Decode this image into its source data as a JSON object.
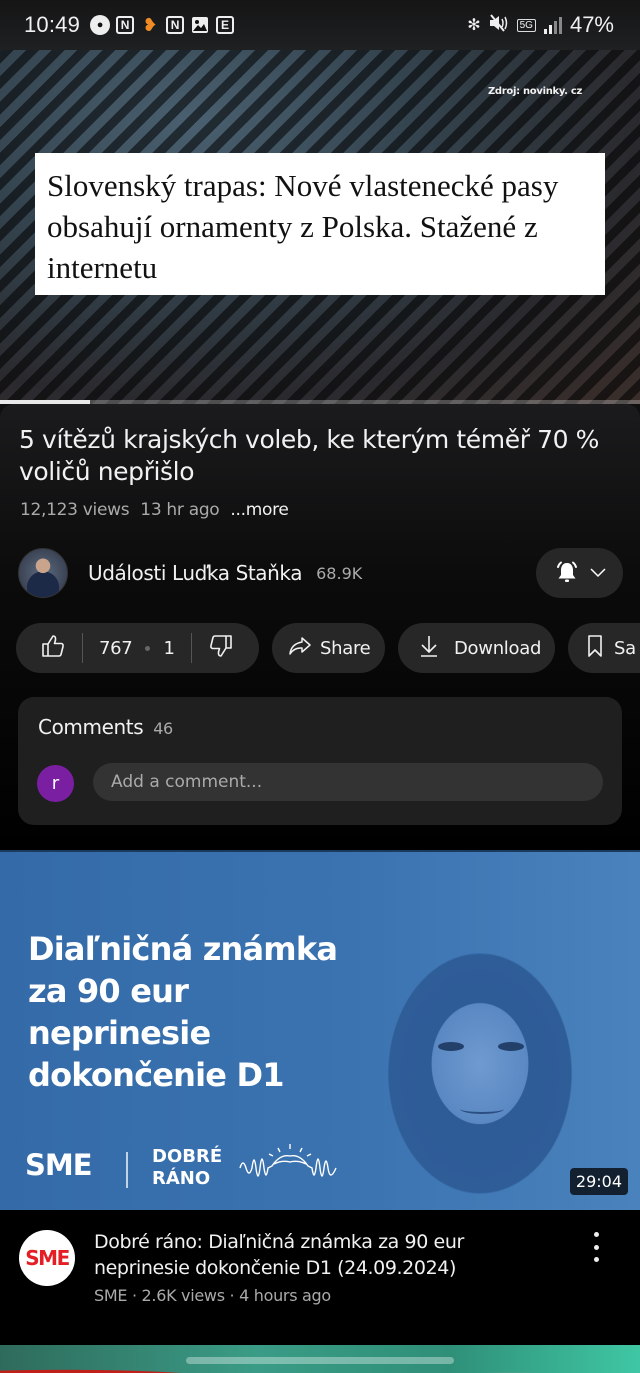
{
  "status_bar": {
    "time": "10:49",
    "left_icons": [
      "chat-bubble-lock-icon",
      "n-app-icon",
      "orange-heart-app-icon",
      "n-app-icon",
      "gallery-icon",
      "e-app-icon"
    ],
    "right_icons": [
      "bluetooth-icon",
      "mute-icon",
      "5g-icon",
      "signal-icon"
    ],
    "network": "5G",
    "battery": "47%"
  },
  "player": {
    "source_label": "Zdroj: novinky. cz",
    "headline": "Slovenský trapas: Nové vlastenecké pasy obsahují ornamenty z Polska. Stažené z internetu",
    "progress_percent": 14
  },
  "video": {
    "title": "5 vítězů krajských voleb, ke kterým téměř 70 % voličů nepřišlo",
    "views": "12,123 views",
    "age": "13 hr ago",
    "more_label": "...more"
  },
  "channel": {
    "name": "Události Luďka Staňka",
    "subscribers": "68.9K",
    "bell_icon": "bell-ringing-icon",
    "chevron_icon": "chevron-down-icon"
  },
  "actions": {
    "likes": "767",
    "dislikes": "1",
    "share_label": "Share",
    "download_label": "Download",
    "save_label": "Sa"
  },
  "comments": {
    "label": "Comments",
    "count": "46",
    "user_initial": "r",
    "input_placeholder": "Add a comment..."
  },
  "next_video": {
    "thumbnail_title": "Diaľničná známka za 90 eur neprinesie dokončenie D1",
    "thumbnail_brand": "SME",
    "thumbnail_show_line1": "DOBRÉ",
    "thumbnail_show_line2": "RÁNO",
    "duration": "29:04",
    "channel_avatar_text": "SME",
    "title": "Dobré ráno: Diaľničná známka za 90 eur neprinesie dokončenie D1 (24.09.2024)",
    "meta": "SME · 2.6K views · 4 hours ago"
  },
  "colors": {
    "background": "#0f0f0f",
    "pill": "#272727",
    "comment_avatar": "#7b1fa2",
    "thumbnail_blue": "#3b73b1",
    "sme_red": "#e31e24"
  }
}
